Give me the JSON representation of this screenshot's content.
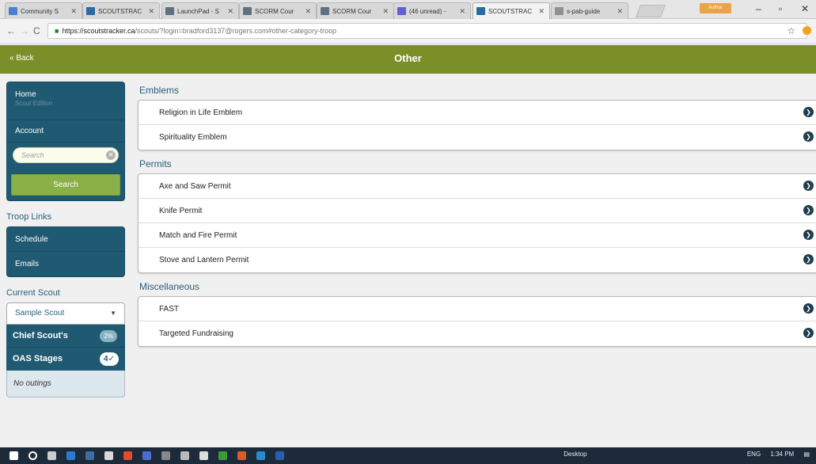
{
  "browser": {
    "tabs": [
      {
        "label": "Community S",
        "color": "#4a7fd0"
      },
      {
        "label": "SCOUTSTRAC",
        "color": "#2a6aa0"
      },
      {
        "label": "LaunchPad - S",
        "color": "#607080"
      },
      {
        "label": "SCORM Cour",
        "color": "#607080"
      },
      {
        "label": "SCORM Cour",
        "color": "#607080"
      },
      {
        "label": "(46 unread) -",
        "color": "#6060d0"
      },
      {
        "label": "SCOUTSTRAC",
        "color": "#2a6aa0"
      },
      {
        "label": "s-pab-guide",
        "color": "#909090"
      }
    ],
    "url_host": "https://scoutstracker.ca",
    "url_path": "/scouts/?login=bradford3137@rogers.com#other-category-troop",
    "profile_label": "Author"
  },
  "page": {
    "back_label": "« Back",
    "title": "Other"
  },
  "sidebar": {
    "home_label": "Home",
    "home_sub": "Scout Edition",
    "account_label": "Account",
    "search_placeholder": "Search",
    "search_button": "Search",
    "troop_links_heading": "Troop Links",
    "troop_links": [
      "Schedule",
      "Emails"
    ],
    "current_scout_heading": "Current Scout",
    "selected_scout": "Sample Scout",
    "chief_scout_label": "Chief Scout's",
    "chief_scout_badge": "2%",
    "oas_label": "OAS Stages",
    "oas_badge": "4✓",
    "outings_text": "No outings"
  },
  "groups": [
    {
      "heading": "Emblems",
      "items": [
        "Religion in Life Emblem",
        "Spirituality Emblem"
      ]
    },
    {
      "heading": "Permits",
      "items": [
        "Axe and Saw Permit",
        "Knife Permit",
        "Match and Fire Permit",
        "Stove and Lantern Permit"
      ]
    },
    {
      "heading": "Miscellaneous",
      "items": [
        "FAST",
        "Targeted Fundraising"
      ]
    }
  ],
  "taskbar": {
    "desktop_label": "Desktop",
    "lang": "ENG",
    "time": "1:34 PM"
  },
  "colors": {
    "accent_green": "#7b8f29",
    "sidebar_blue": "#1f5a72",
    "button_green": "#8ab048"
  }
}
